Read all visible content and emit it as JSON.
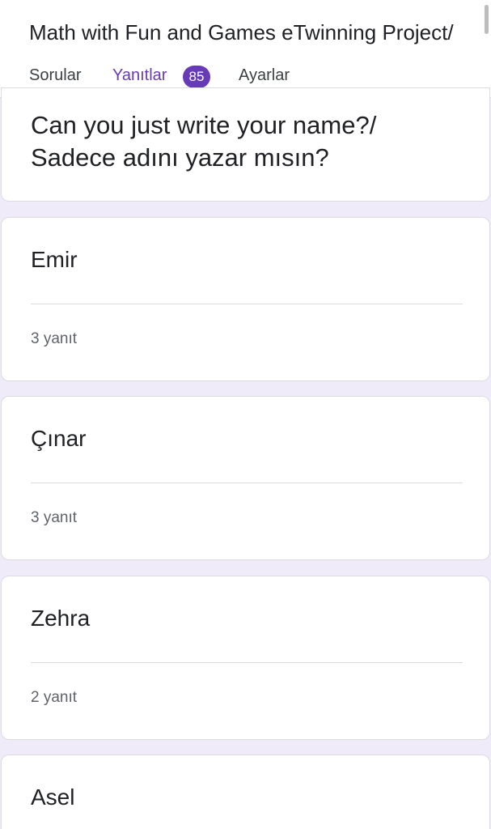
{
  "form": {
    "title": "Math with Fun and Games eTwinning Project/"
  },
  "tabs": {
    "questions_label": "Sorular",
    "responses_label": "Yanıtlar",
    "responses_count": "85",
    "settings_label": "Ayarlar",
    "active": "Yanıtlar"
  },
  "question": {
    "line1": "Can you just write your  name?/",
    "line2": "Sadece adını yazar mısın?"
  },
  "answers": [
    {
      "text": "Emir",
      "count": "3 yanıt"
    },
    {
      "text": "Çınar",
      "count": "3 yanıt"
    },
    {
      "text": "Zehra",
      "count": "2 yanıt"
    },
    {
      "text": "Asel",
      "count": ""
    }
  ],
  "colors": {
    "accent": "#673ab7",
    "background": "#f0ebf8",
    "card": "#ffffff"
  }
}
